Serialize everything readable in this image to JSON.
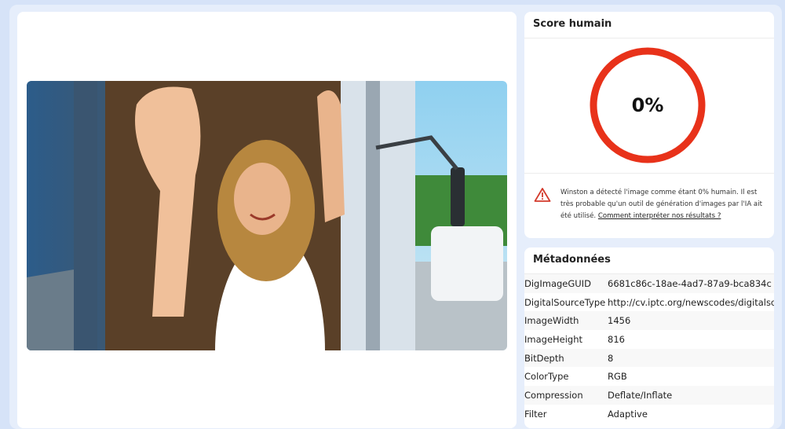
{
  "score_panel": {
    "title": "Score humain",
    "score_text": "0%",
    "score_fraction": 0.0,
    "ring_color": "#e8321a",
    "warning_icon": "warning-triangle-icon",
    "warning_text": "Winston a détecté l'image comme étant 0% humain. Il est très probable qu'un outil de génération d'images par l'IA ait été utilisé.",
    "warning_link": "Comment interpréter nos résultats ?"
  },
  "metadata_panel": {
    "title": "Métadonnées",
    "rows": [
      {
        "key": "DigImageGUID",
        "value": "6681c86c-18ae-4ad7-87a9-bca834c"
      },
      {
        "key": "DigitalSourceType",
        "value": "http://cv.iptc.org/newscodes/digitalsc"
      },
      {
        "key": "ImageWidth",
        "value": "1456"
      },
      {
        "key": "ImageHeight",
        "value": "816"
      },
      {
        "key": "BitDepth",
        "value": "8"
      },
      {
        "key": "ColorType",
        "value": "RGB"
      },
      {
        "key": "Compression",
        "value": "Deflate/Inflate"
      },
      {
        "key": "Filter",
        "value": "Adaptive"
      }
    ]
  }
}
